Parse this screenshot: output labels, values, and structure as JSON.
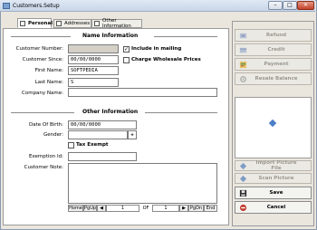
{
  "window": {
    "title": "Customers.Setup",
    "minimize": "–",
    "maximize": "□",
    "close": "✕"
  },
  "tabs": [
    {
      "label": "Personal",
      "active": true
    },
    {
      "label": "Addresses",
      "active": false
    },
    {
      "label": "Other Information",
      "active": false
    }
  ],
  "name_info": {
    "title": "Name Information",
    "customer_number_label": "Customer Number:",
    "customer_number_value": "",
    "include_in_mailing_label": "Include in mailing",
    "include_in_mailing_checked": true,
    "customer_since_label": "Customer Since:",
    "customer_since_value": "00/00/0000",
    "charge_wholesale_label": "Charge Wholesale Prices",
    "charge_wholesale_checked": false,
    "first_name_label": "First Name:",
    "first_name_value": "SOFTPEDIA",
    "last_name_label": "Last Name:",
    "last_name_value": "S",
    "company_name_label": "Company Name:",
    "company_name_value": ""
  },
  "other_info": {
    "title": "Other Information",
    "dob_label": "Date Of Birth:",
    "dob_value": "00/00/0000",
    "gender_label": "Gender:",
    "gender_value": "",
    "gender_button": "+",
    "tax_exempt_label": "Tax Exempt",
    "tax_exempt_checked": false,
    "exemption_label": "Exemption Id:",
    "exemption_value": "",
    "customer_note_label": "Customer Note:",
    "customer_note_value": ""
  },
  "note_nav": {
    "home": "Home",
    "pgup": "PgUp",
    "prev": "◀",
    "page": "1",
    "of": "OF",
    "total": "1",
    "next": "▶",
    "pgdn": "PgDn",
    "end": "End"
  },
  "side_buttons": {
    "refund": "Refund",
    "credit": "Credit",
    "payment": "Payment",
    "resale_balance": "Resale Balance",
    "import_picture": "Import Picture File",
    "scan_picture": "Scan Picture",
    "save": "Save",
    "cancel": "Cancel"
  },
  "colors": {
    "accent": "#4d7fc7",
    "cancel": "#c0392b",
    "disabled_text": "#9a9890"
  },
  "icons": [
    "refund-icon",
    "credit-icon",
    "payment-icon",
    "resale-balance-icon",
    "import-picture-icon",
    "scan-picture-icon",
    "save-icon",
    "cancel-icon"
  ]
}
